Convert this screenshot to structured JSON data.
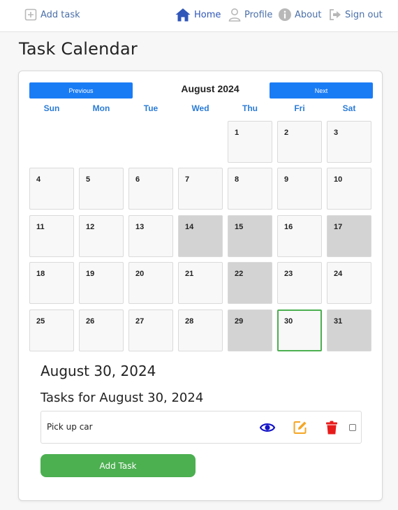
{
  "nav": {
    "add_task": "Add task",
    "home": "Home",
    "profile": "Profile",
    "about": "About",
    "sign_out": "Sign out"
  },
  "page": {
    "title": "Task Calendar"
  },
  "calendar": {
    "prev_label": "Previous",
    "next_label": "Next",
    "month_label": "August 2024",
    "weekdays": [
      "Sun",
      "Mon",
      "Tue",
      "Wed",
      "Thu",
      "Fri",
      "Sat"
    ],
    "days": [
      "1",
      "2",
      "3",
      "4",
      "5",
      "6",
      "7",
      "8",
      "9",
      "10",
      "11",
      "12",
      "13",
      "14",
      "15",
      "16",
      "17",
      "18",
      "19",
      "20",
      "21",
      "22",
      "23",
      "24",
      "25",
      "26",
      "27",
      "28",
      "29",
      "30",
      "31"
    ],
    "highlighted_days": [
      "14",
      "15",
      "17",
      "22",
      "29",
      "31"
    ],
    "selected_day": "30"
  },
  "selected": {
    "date_label": "August 30, 2024",
    "tasks_heading": "Tasks for August 30, 2024",
    "tasks": [
      {
        "name": "Pick up car",
        "actions": [
          "eye-icon",
          "edit-icon",
          "trash-icon"
        ],
        "checked": false
      }
    ],
    "add_task_label": "Add Task"
  },
  "colors": {
    "accent_blue": "#1a7cf5",
    "weekday_blue": "#2a7bd6",
    "highlight_gray": "#d3d3d3",
    "selected_green": "#4caf50",
    "eye_blue": "#1414c8",
    "edit_orange": "#f5a623",
    "trash_red": "#e81b1b"
  }
}
